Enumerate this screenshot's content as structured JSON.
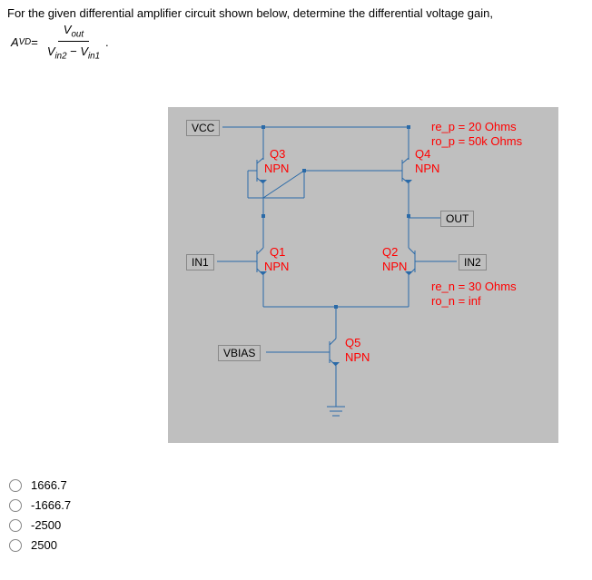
{
  "question": {
    "text": "For the given differential amplifier circuit shown below, determine the differential voltage gain, ",
    "gain_symbol": "A",
    "gain_sub": "VD",
    "eq": " = ",
    "num": "V",
    "num_sub": "out",
    "den_left": "V",
    "den_left_sub": "in2",
    "minus": " − ",
    "den_right": "V",
    "den_right_sub": "in1",
    "tail": "."
  },
  "ports": {
    "vcc": "VCC",
    "in1": "IN1",
    "in2": "IN2",
    "out": "OUT",
    "vbias": "VBIAS"
  },
  "transistors": {
    "q1": {
      "name": "Q1",
      "type": "NPN"
    },
    "q2": {
      "name": "Q2",
      "type": "NPN"
    },
    "q3": {
      "name": "Q3",
      "type": "NPN"
    },
    "q4": {
      "name": "Q4",
      "type": "NPN"
    },
    "q5": {
      "name": "Q5",
      "type": "NPN"
    }
  },
  "params": {
    "re_p": "re_p = 20 Ohms",
    "ro_p": "ro_p = 50k Ohms",
    "re_n": "re_n = 30 Ohms",
    "ro_n": "ro_n = inf"
  },
  "options": [
    "1666.7",
    "-1666.7",
    "-2500",
    "2500"
  ]
}
